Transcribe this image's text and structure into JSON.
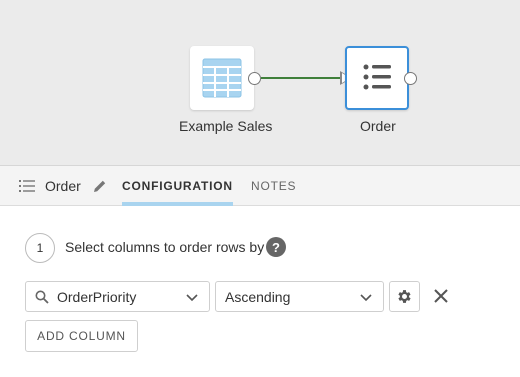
{
  "canvas": {
    "nodes": [
      {
        "label": "Example Sales",
        "icon": "table-icon"
      },
      {
        "label": "Order",
        "icon": "ordered-list-icon"
      }
    ]
  },
  "tabbar": {
    "step_name": "Order",
    "tabs": [
      {
        "label": "CONFIGURATION",
        "active": true
      },
      {
        "label": "NOTES",
        "active": false
      }
    ]
  },
  "config": {
    "step_number": "1",
    "instruction": "Select columns to order rows by",
    "help_label": "?",
    "row": {
      "column": "OrderPriority",
      "direction": "Ascending"
    },
    "add_column_label": "ADD COLUMN"
  },
  "colors": {
    "accent": "#3b8fd9",
    "wire": "#3f7f3a",
    "tab_underline": "#a9d4ef",
    "table_icon": "#a8d4f0"
  }
}
